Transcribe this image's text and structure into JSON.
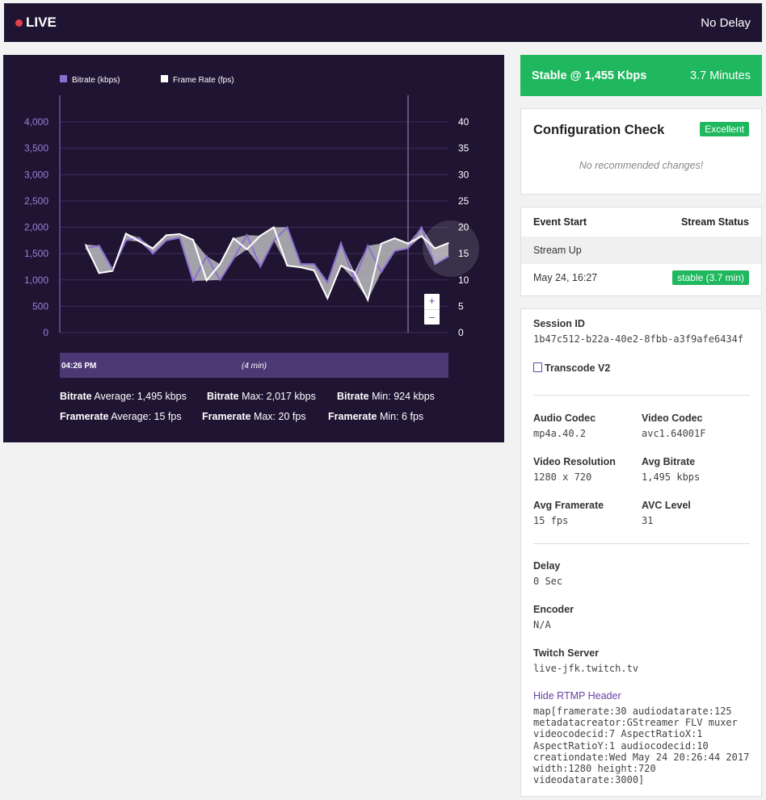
{
  "header": {
    "live_label": "LIVE",
    "delay_label": "No Delay"
  },
  "status_bar": {
    "status": "Stable @ 1,455 Kbps",
    "duration": "3.7 Minutes"
  },
  "chart_data": {
    "type": "line",
    "legend": [
      "Bitrate (kbps)",
      "Frame Rate (fps)"
    ],
    "y_left_ticks": [
      "0",
      "500",
      "1,000",
      "1,500",
      "2,000",
      "2,500",
      "3,000",
      "3,500",
      "4,000"
    ],
    "y_right_ticks": [
      "0",
      "5",
      "10",
      "15",
      "20",
      "25",
      "30",
      "35",
      "40"
    ],
    "y_left_range": [
      0,
      4000
    ],
    "y_right_range": [
      0,
      40
    ],
    "series": [
      {
        "name": "Bitrate (kbps)",
        "color": "#8b6fd0",
        "values": [
          1600,
          1650,
          1200,
          1750,
          1800,
          1500,
          1750,
          1800,
          980,
          1450,
          1000,
          1400,
          1850,
          1250,
          1750,
          2000,
          1300,
          1300,
          950,
          1700,
          1000,
          1650,
          1150,
          1550,
          1600,
          2000,
          1300,
          1450
        ]
      },
      {
        "name": "Frame Rate (fps)",
        "color": "#ffffff",
        "values": [
          16.7,
          11.3,
          11.7,
          18.8,
          17.3,
          16,
          18.5,
          18.7,
          17.6,
          9.9,
          13,
          17.9,
          15.8,
          18.4,
          20,
          12.7,
          12.4,
          11.8,
          6.5,
          12.7,
          11.5,
          6.2,
          16.9,
          17.9,
          16.9,
          18.3,
          16,
          17
        ]
      }
    ],
    "x_label_start": "04:26 PM",
    "x_label_duration": "(4 min)",
    "stats": {
      "bitrate_avg": "1,495 kbps",
      "bitrate_max": "2,017 kbps",
      "bitrate_min": "924 kbps",
      "framerate_avg": "15 fps",
      "framerate_max": "20 fps",
      "framerate_min": "6 fps"
    }
  },
  "stats_labels": {
    "bitrate": "Bitrate",
    "framerate": "Framerate",
    "average": "Average:",
    "max": "Max:",
    "min": "Min:"
  },
  "zoom": {
    "in": "+",
    "out": "–"
  },
  "config_check": {
    "title": "Configuration Check",
    "badge": "Excellent",
    "message": "No recommended changes!"
  },
  "event_table": {
    "col_event": "Event Start",
    "col_status": "Stream Status",
    "rows": [
      {
        "event": "Stream Up",
        "status": ""
      },
      {
        "event": "May 24, 16:27",
        "status": "stable (3.7 min)"
      }
    ]
  },
  "session": {
    "session_id_label": "Session ID",
    "session_id": "1b47c512-b22a-40e2-8fbb-a3f9afe6434f",
    "transcode": "Transcode V2",
    "audio_codec_label": "Audio Codec",
    "audio_codec": "mp4a.40.2",
    "video_codec_label": "Video Codec",
    "video_codec": "avc1.64001F",
    "resolution_label": "Video Resolution",
    "resolution": "1280 x 720",
    "avg_bitrate_label": "Avg Bitrate",
    "avg_bitrate": "1,495 kbps",
    "avg_framerate_label": "Avg Framerate",
    "avg_framerate": "15 fps",
    "avc_level_label": "AVC Level",
    "avc_level": "31",
    "delay_label": "Delay",
    "delay": "0 Sec",
    "encoder_label": "Encoder",
    "encoder": "N/A",
    "server_label": "Twitch Server",
    "server": "live-jfk.twitch.tv",
    "rtmp_toggle": "Hide RTMP Header",
    "rtmp_lines": [
      "map[framerate:30 audiodatarate:125",
      "metadatacreator:GStreamer FLV muxer",
      "videocodecid:7 AspectRatioX:1",
      "AspectRatioY:1 audiocodecid:10",
      "creationdate:Wed May 24 20:26:44 2017",
      "width:1280 height:720",
      "videodatarate:3000]"
    ]
  }
}
